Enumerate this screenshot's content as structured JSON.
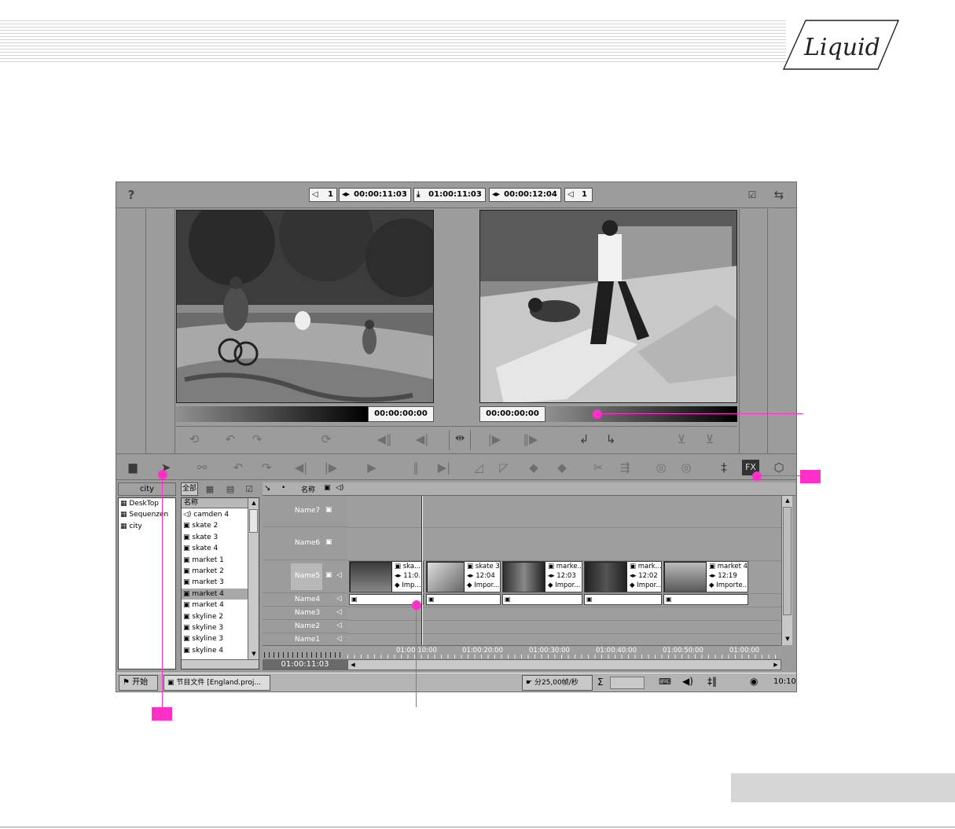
{
  "brand": {
    "logo_text": "Liquid"
  },
  "topbar": {
    "left_counter": "1",
    "tc_duration": "00:00:11:03",
    "tc_position": "01:00:11:03",
    "tc_master": "00:00:12:04",
    "right_counter": "1"
  },
  "viewers": {
    "source_tc": "00:00:00:00",
    "master_tc": "00:00:00:00"
  },
  "project": {
    "name": "city"
  },
  "tree": [
    "DeskTop",
    "Sequenzen",
    "city"
  ],
  "rack": {
    "tab_all": "全部",
    "column_name": "名称",
    "clips": [
      "camden 4",
      "skate 2",
      "skate 3",
      "skate 4",
      "market 1",
      "market 2",
      "market 3",
      "market 4",
      "market 4",
      "skyline 2",
      "skyline 3",
      "skyline 3",
      "skyline 4"
    ]
  },
  "timeline": {
    "col_name": "名称",
    "tracks": [
      "Name7",
      "Name6",
      "Name5",
      "Name4",
      "Name3",
      "Name2",
      "Name1"
    ],
    "current_tc": "01:00:11:03",
    "ruler": [
      "01:00:10:00",
      "01:00:20:00",
      "01:00:30:00",
      "01:00:40:00",
      "01:00:50:00",
      "01:00:00"
    ],
    "clips": [
      {
        "name": "ska...",
        "tc": "11:0...",
        "status": "Imp..."
      },
      {
        "name": "skate 3",
        "tc": "12:04",
        "status": "Impor..."
      },
      {
        "name": "marke...",
        "tc": "12:03",
        "status": "Impor..."
      },
      {
        "name": "mark...",
        "tc": "12:02",
        "status": "Impor..."
      },
      {
        "name": "market 4",
        "tc": "12:19",
        "status": "Importe..."
      }
    ]
  },
  "taskbar": {
    "start": "开始",
    "task": "节目文件 [England.proj...",
    "fps": "分25,00帧/秒",
    "sigma": "Σ",
    "clock": "10:10"
  }
}
